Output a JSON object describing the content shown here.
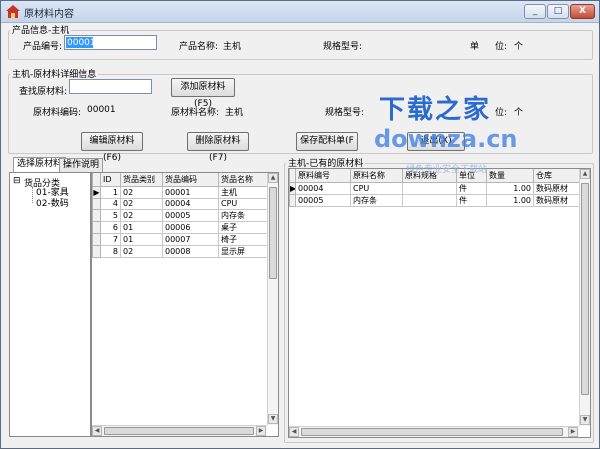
{
  "window": {
    "title": "原材料内容",
    "min": "_",
    "max": "□",
    "close": "X"
  },
  "product_group": {
    "title": "产品信息-主机",
    "code_label": "产品编号:",
    "code_value": "00001",
    "name_label": "产品名称:",
    "name_value": "主机",
    "model_label": "规格型号:",
    "unit_label": "单",
    "unit_label2": "位:",
    "unit_value": "个"
  },
  "detail_group": {
    "title": "主机-原材料详细信息",
    "search_label": "查找原材料:",
    "search_value": "",
    "add_button": "添加原材料(F5)",
    "mat_code_label": "原材料编码:",
    "mat_code_value": "00001",
    "mat_name_label": "原材料名称:",
    "mat_name_value": "主机",
    "mat_model_label": "规格型号:",
    "mat_unit_label": "位:",
    "mat_unit_value": "个",
    "edit_button": "编辑原材料(F6)",
    "delete_button": "删除原材料(F7)",
    "save_button": "保存配料单(F",
    "exit_button": "退出(X)"
  },
  "tabs": [
    "选择原材料",
    "操作说明"
  ],
  "tree": {
    "root": "货品分类",
    "expander": "⊟",
    "children": [
      "01-家具",
      "02-数码"
    ]
  },
  "left_grid": {
    "columns": [
      "ID",
      "货品类别",
      "货品编码",
      "货品名称"
    ],
    "rows": [
      [
        "1",
        "02",
        "00001",
        "主机"
      ],
      [
        "4",
        "02",
        "00004",
        "CPU"
      ],
      [
        "5",
        "02",
        "00005",
        "内存条"
      ],
      [
        "6",
        "01",
        "00006",
        "桌子"
      ],
      [
        "7",
        "01",
        "00007",
        "椅子"
      ],
      [
        "8",
        "02",
        "00008",
        "显示屏"
      ]
    ]
  },
  "right_group": {
    "title": "主机-已有的原材料"
  },
  "right_grid": {
    "columns": [
      "原料编号",
      "原料名称",
      "原料规格",
      "单位",
      "数量",
      "仓库"
    ],
    "rows": [
      [
        "00004",
        "CPU",
        "",
        "件",
        "1.00",
        "数码原材"
      ],
      [
        "00005",
        "内存条",
        "",
        "件",
        "1.00",
        "数码原材"
      ]
    ]
  },
  "watermark": {
    "cn": "下载之家",
    "en": "downza.cn",
    "note": "绿色专业安全下载站"
  },
  "colors": {
    "titlebar": "#c4d5ea",
    "selection": "#3399ff",
    "watermark": "#2b6ad0"
  }
}
